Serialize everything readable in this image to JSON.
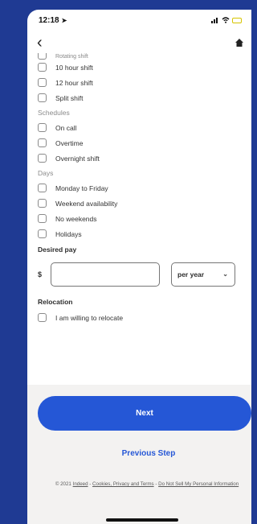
{
  "status_bar": {
    "time": "12:18",
    "location_icon": "location-arrow-icon",
    "signal_icon": "cellular-signal-icon",
    "wifi_icon": "wifi-icon",
    "battery_icon": "battery-low-icon"
  },
  "nav": {
    "back_icon": "chevron-left-icon",
    "home_icon": "home-icon"
  },
  "cut_item": "Rotating shift",
  "shifts": [
    {
      "label": "10 hour shift",
      "checked": false
    },
    {
      "label": "12 hour shift",
      "checked": false
    },
    {
      "label": "Split shift",
      "checked": false
    }
  ],
  "schedules": {
    "title": "Schedules",
    "items": [
      {
        "label": "On call",
        "checked": false
      },
      {
        "label": "Overtime",
        "checked": false
      },
      {
        "label": "Overnight shift",
        "checked": false
      }
    ]
  },
  "days": {
    "title": "Days",
    "items": [
      {
        "label": "Monday to Friday",
        "checked": false
      },
      {
        "label": "Weekend availability",
        "checked": false
      },
      {
        "label": "No weekends",
        "checked": false
      },
      {
        "label": "Holidays",
        "checked": false
      }
    ]
  },
  "desired_pay": {
    "label": "Desired pay",
    "currency": "$",
    "amount_value": "",
    "period_selected": "per year"
  },
  "relocation": {
    "label": "Relocation",
    "checkbox_label": "I am willing to relocate",
    "checked": false
  },
  "actions": {
    "next_label": "Next",
    "previous_label": "Previous Step"
  },
  "legal": {
    "copyright": "© 2021",
    "indeed": "Indeed",
    "sep1": " - ",
    "cookies": "Cookies, Privacy and Terms",
    "sep2": " - ",
    "do_not_sell": "Do Not Sell My Personal Information"
  },
  "colors": {
    "background": "#1f3a93",
    "accent": "#2557d6",
    "footer_bg": "#f3f2f1"
  }
}
